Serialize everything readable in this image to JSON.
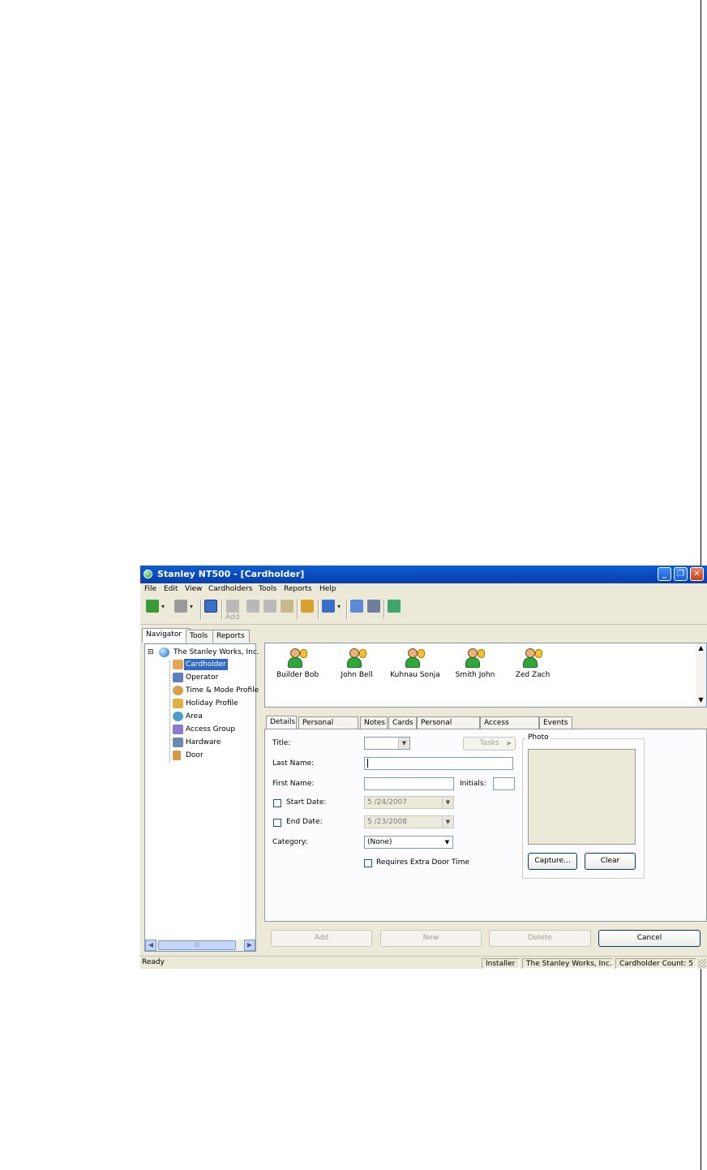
{
  "window": {
    "title": "Stanley NT500 - [Cardholder]",
    "min_glyph": "_",
    "max_glyph": "❐",
    "close_glyph": "✕"
  },
  "menu": [
    "File",
    "Edit",
    "View",
    "Cardholders",
    "Tools",
    "Reports",
    "Help"
  ],
  "toolbar": {
    "add_caption": "Add"
  },
  "nav_tabs": [
    "Navigator",
    "Tools",
    "Reports"
  ],
  "tree": {
    "root": "The Stanley Works, Inc.",
    "expander": "⊟",
    "items": [
      "Cardholder",
      "Operator",
      "Time & Mode Profile",
      "Holiday Profile",
      "Area",
      "Access Group",
      "Hardware",
      "Door"
    ]
  },
  "cardholders": [
    "Builder Bob",
    "John Bell",
    "Kuhnau Sonja",
    "Smith John",
    "Zed Zach"
  ],
  "detail_tabs": [
    "Details",
    "Personal Details",
    "Notes",
    "Cards",
    "Personal Access",
    "Access Groups",
    "Events"
  ],
  "form": {
    "title_label": "Title:",
    "last_name_label": "Last Name:",
    "first_name_label": "First Name:",
    "initials_label": "Initials:",
    "start_date_label": "Start Date:",
    "start_date_value": "5 /24/2007",
    "end_date_label": "End Date:",
    "end_date_value": "5 /23/2008",
    "category_label": "Category:",
    "category_value": "(None)",
    "extra_door_label": "Requires Extra Door Time",
    "tasks_label": "Tasks",
    "photo_label": "Photo",
    "capture_label": "Capture...",
    "clear_label": "Clear"
  },
  "actions": {
    "add": "Add",
    "new": "New",
    "delete": "Delete",
    "cancel": "Cancel"
  },
  "status": {
    "ready": "Ready",
    "user": "Installer",
    "company": "The Stanley Works, Inc.",
    "count": "Cardholder Count: 5"
  },
  "colors": {
    "titlebar": "#0a5fd8",
    "selection": "#316ac5",
    "window_bg": "#ece9d8"
  }
}
